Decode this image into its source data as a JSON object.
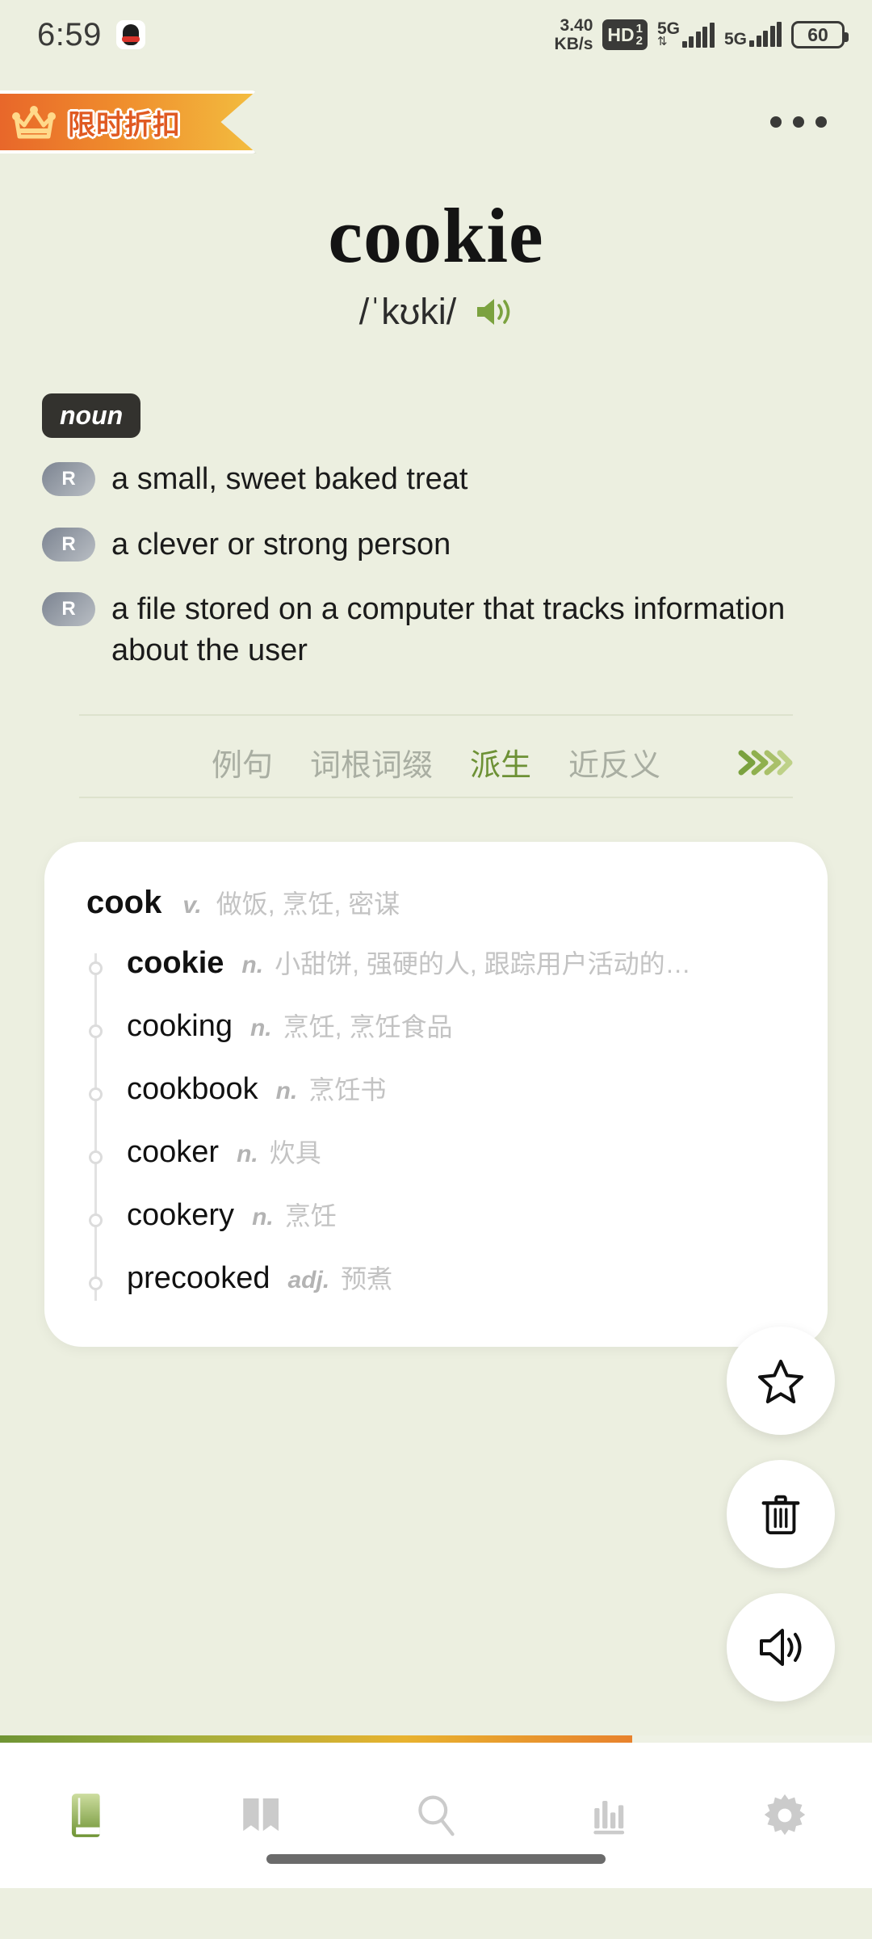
{
  "status_bar": {
    "time": "6:59",
    "app_icon": "qq-penguin-icon",
    "network_speed_value": "3.40",
    "network_speed_unit": "KB/s",
    "hd_label": "HD",
    "hd_sim_top": "1",
    "hd_sim_bottom": "2",
    "sim1_network": "5G",
    "sim2_network": "5G",
    "battery_percent": "60"
  },
  "header": {
    "promo_label": "限时折扣",
    "promo_icon": "crown-icon",
    "promo_gradient_start": "#e8672a",
    "promo_gradient_end": "#f3bc3f",
    "overflow_menu_icon": "more-horizontal-icon"
  },
  "word": {
    "headword": "cookie",
    "phonetic": "/ˈkʊki/",
    "pronounce_icon": "speaker-icon",
    "accent_color": "#6d9135"
  },
  "definitions": {
    "part_of_speech": "noun",
    "badge_letter": "R",
    "senses": [
      "a small, sweet baked treat",
      "a clever or strong person",
      "a file stored on a computer that tracks information about the user"
    ]
  },
  "tabs": {
    "items": [
      {
        "label": "例句",
        "active": false
      },
      {
        "label": "词根词缀",
        "active": false
      },
      {
        "label": "派生",
        "active": true
      },
      {
        "label": "近反义",
        "active": false
      }
    ],
    "more_icon": "double-chevron-right-icon"
  },
  "word_family": {
    "root": {
      "word": "cook",
      "pos": "v.",
      "definition": "做饭, 烹饪, 密谋"
    },
    "items": [
      {
        "word": "cookie",
        "pos": "n.",
        "definition": "小甜饼, 强硬的人, 跟踪用户活动的…",
        "current": true
      },
      {
        "word": "cooking",
        "pos": "n.",
        "definition": "烹饪, 烹饪食品",
        "current": false
      },
      {
        "word": "cookbook",
        "pos": "n.",
        "definition": "烹饪书",
        "current": false
      },
      {
        "word": "cooker",
        "pos": "n.",
        "definition": "炊具",
        "current": false
      },
      {
        "word": "cookery",
        "pos": "n.",
        "definition": "烹饪",
        "current": false
      },
      {
        "word": "precooked",
        "pos": "adj.",
        "definition": "预煮",
        "current": false
      }
    ]
  },
  "floating_actions": [
    {
      "name": "favorite-button",
      "icon": "star-icon"
    },
    {
      "name": "delete-button",
      "icon": "trash-icon"
    },
    {
      "name": "pronounce-button",
      "icon": "speaker-icon"
    }
  ],
  "progress": {
    "percent": "72.5"
  },
  "bottom_nav": {
    "items": [
      {
        "name": "nav-wordbook",
        "icon": "green-book-icon",
        "active": true
      },
      {
        "name": "nav-reading",
        "icon": "open-book-icon",
        "active": false
      },
      {
        "name": "nav-search",
        "icon": "search-icon",
        "active": false
      },
      {
        "name": "nav-statistics",
        "icon": "bar-chart-icon",
        "active": false
      },
      {
        "name": "nav-settings",
        "icon": "gear-icon",
        "active": false
      }
    ]
  }
}
